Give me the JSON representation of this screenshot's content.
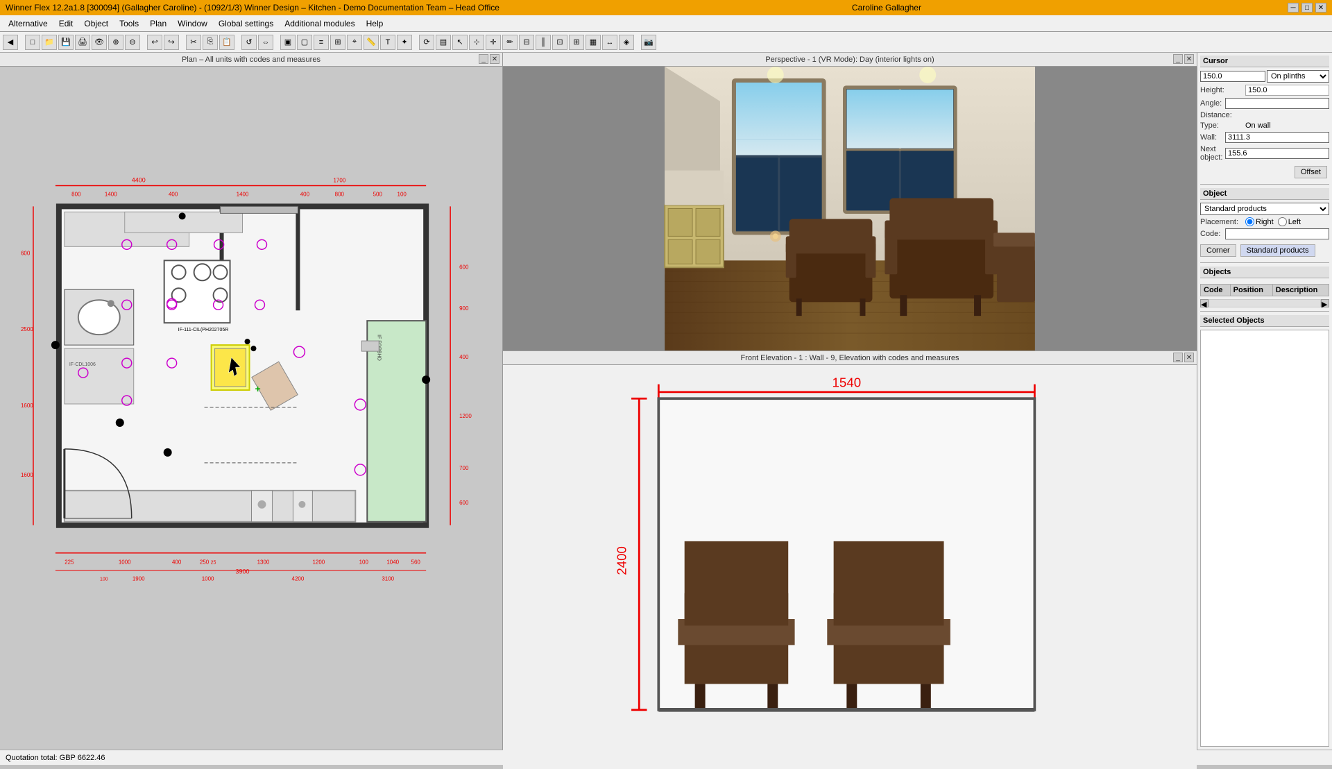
{
  "title_bar": {
    "title": "Winner Flex 12.2a1.8  [300094]  (Gallagher Caroline) - (1092/1/3) Winner Design – Kitchen - Demo  Documentation Team – Head Office",
    "user": "Caroline Gallagher",
    "min_label": "─",
    "max_label": "□",
    "close_label": "✕"
  },
  "menu": {
    "items": [
      "Alternative",
      "Edit",
      "Object",
      "Tools",
      "Plan",
      "Window",
      "Global settings",
      "Additional modules",
      "Help"
    ]
  },
  "panels": {
    "floor_plan_title": "Plan  – All units with codes and measures",
    "view3d_title": "Perspective - 1 (VR Mode): Day (interior lights on)",
    "elevation_title": "Front Elevation - 1 : Wall - 9, Elevation with codes and measures"
  },
  "cursor_panel": {
    "title": "Cursor",
    "height_label": "Height:",
    "height_value": "150.0",
    "on_plinths_label": "On plinths",
    "angle_label": "Angle:",
    "angle_value": "",
    "distance_label": "Distance:",
    "type_label": "Type:",
    "type_value": "On wall",
    "wall_label": "Wall:",
    "wall_value": "3111.3",
    "next_obj_label": "Next object:",
    "next_obj_value": "155.6",
    "offset_btn": "Offset"
  },
  "object_panel": {
    "title": "Object",
    "dropdown_value": "Standard products",
    "placement_label": "Placement:",
    "right_label": "Right",
    "left_label": "Left",
    "code_label": "Code:",
    "code_value": "",
    "corner_btn": "Corner",
    "std_products_btn": "Standard products"
  },
  "objects_table": {
    "title": "Objects",
    "columns": [
      "Code",
      "Position",
      "Description"
    ],
    "rows": []
  },
  "selected_objects": {
    "title": "Selected Objects"
  },
  "status_bar": {
    "quotation": "Quotation total:  GBP 6622.46"
  },
  "elevation_dim": "1540",
  "elevation_height": "2400",
  "cursor_height_dropdown": "150.0",
  "on_plinths_text": "On plinths"
}
